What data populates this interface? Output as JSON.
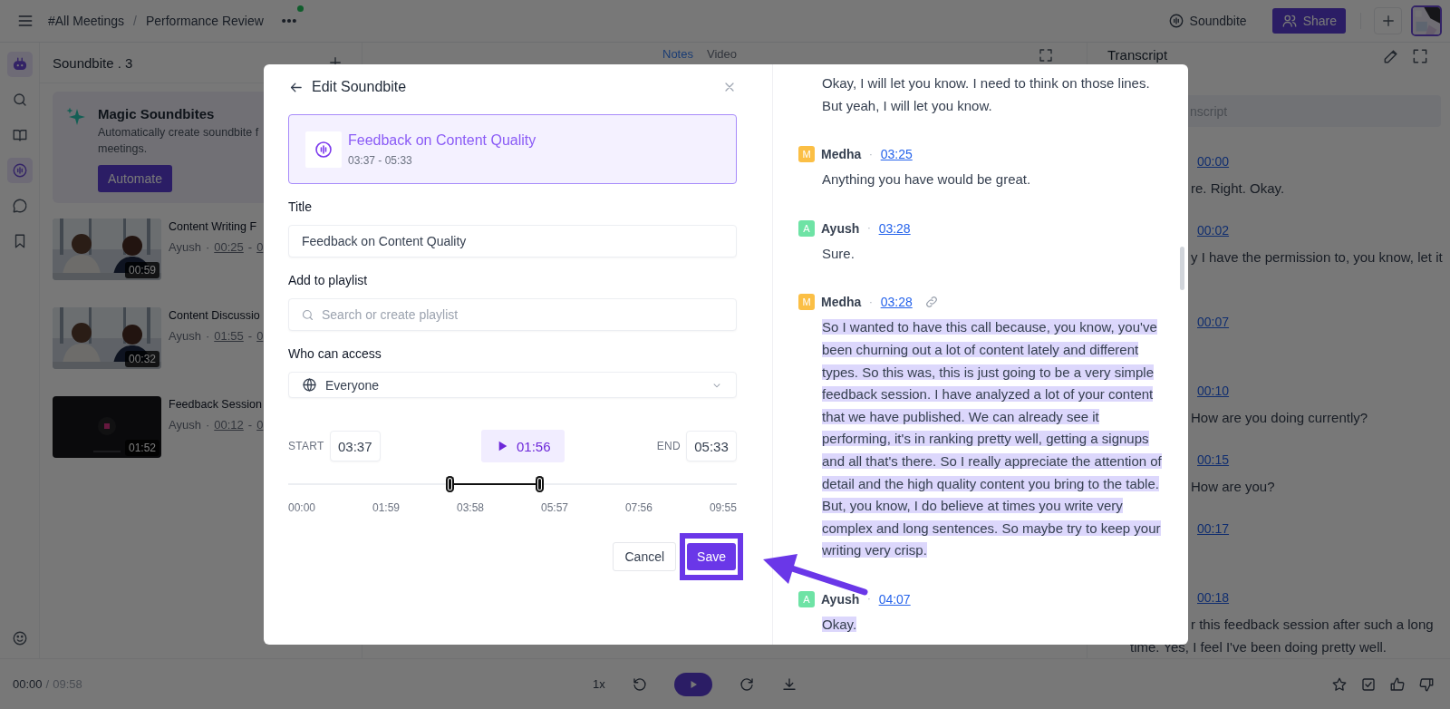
{
  "top_bar": {
    "breadcrumb": [
      {
        "label": "#All Meetings"
      },
      {
        "label": "Performance Review"
      }
    ],
    "separator": "/",
    "more_badge": true,
    "soundbite_button": "Soundbite",
    "share_button": "Share"
  },
  "rail": {
    "items": [
      {
        "kind": "bot",
        "selected": true
      },
      {
        "kind": "search",
        "selected": false
      },
      {
        "kind": "book",
        "selected": false
      },
      {
        "kind": "soundbite",
        "selected": true
      },
      {
        "kind": "chat",
        "selected": false
      },
      {
        "kind": "bookmark",
        "selected": false
      }
    ]
  },
  "soundbite_panel": {
    "title": "Soundbite . 3",
    "magic": {
      "title": "Magic Soundbites",
      "description": "Automatically create soundbite f\nmeetings.",
      "button": "Automate"
    },
    "items": [
      {
        "title": "Content Writing F",
        "author": "Ayush",
        "sep": "·",
        "start": "00:25",
        "dash": "-",
        "end": "0",
        "duration": "00:59"
      },
      {
        "title": "Content Discussio",
        "author": "Ayush",
        "sep": "·",
        "start": "01:55",
        "dash": "-",
        "end": "0",
        "duration": "00:32"
      },
      {
        "title": "Feedback Session",
        "author": "Ayush",
        "sep": "·",
        "start": "00:12",
        "dash": "-",
        "end": "0",
        "duration": "01:52"
      }
    ]
  },
  "notes_panel": {
    "tabs": [
      {
        "label": "Notes",
        "selected": true
      },
      {
        "label": "Video",
        "selected": false
      }
    ]
  },
  "transcript_panel": {
    "title": "Transcript",
    "search_placeholder": "nscript",
    "entries": [
      {
        "time": "00:00",
        "kind": "one_line",
        "lines": [
          {
            "text": "re. Right. Okay.",
            "kind": "clipped"
          }
        ]
      },
      {
        "time": "00:02",
        "kind": "two_line",
        "lines": [
          {
            "text": "y I have the permission to, you know, let it",
            "kind": "clipped"
          }
        ]
      },
      {
        "time": "00:07",
        "kind": "one_line"
      },
      {
        "time": "00:10",
        "kind": "one_line",
        "lines": [
          {
            "text": "How are you doing currently?",
            "kind": "clipped"
          }
        ]
      },
      {
        "time": "00:15",
        "kind": "one_line",
        "lines": [
          {
            "text": "How are you?",
            "kind": "clipped"
          }
        ]
      },
      {
        "time": "00:17",
        "kind": "one_line"
      },
      {
        "time": "00:18",
        "kind": "two_line",
        "lines": [
          {
            "text": "r this feedback session after such a long",
            "kind": "clipped"
          },
          {
            "text": "time. Yes, I feel I've been doing pretty well.",
            "kind": "full"
          }
        ]
      }
    ]
  },
  "player": {
    "current": "00:00",
    "separator": "/",
    "total": "09:58",
    "speed": "1x"
  },
  "dialog": {
    "title": "Edit Soundbite",
    "card": {
      "title": "Feedback on Content Quality",
      "range": "03:37 - 05:33"
    },
    "title_label": "Title",
    "title_value": "Feedback on Content Quality",
    "playlist_label": "Add to playlist",
    "playlist_placeholder": "Search or create playlist",
    "access_label": "Who can access",
    "access_value": "Everyone",
    "start_label": "START",
    "start_value": "03:37",
    "duration": "01:56",
    "end_label": "END",
    "end_value": "05:33",
    "handles": [
      {
        "level": 0.36
      },
      {
        "level": 0.56
      }
    ],
    "ticks": [
      "00:00",
      "01:59",
      "03:58",
      "05:57",
      "07:56",
      "09:55"
    ],
    "cancel": "Cancel",
    "save": "Save",
    "save_highlighted": true,
    "transcript": [
      {
        "text": "Okay, I will let you know. I need to think on those lines. But yeah, I will let you know.",
        "highlighted": false
      },
      {
        "speaker": "Medha",
        "initial": "M",
        "color": "#fbbf45",
        "sep": "·",
        "time": "03:25",
        "link": false,
        "text": "Anything you have would be great.",
        "highlighted": false
      },
      {
        "speaker": "Ayush",
        "initial": "A",
        "color": "#6ee3a5",
        "sep": "·",
        "time": "03:28",
        "link": false,
        "text": "Sure.",
        "highlighted": false
      },
      {
        "speaker": "Medha",
        "initial": "M",
        "color": "#fbbf45",
        "sep": "·",
        "time": "03:28",
        "link": true,
        "text": "So I wanted to have this call because, you know, you've been churning out a lot of content lately and different types. So this was, this is just going to be a very simple feedback session. I have analyzed a lot of your content that we have published. We can already see it performing, it's in ranking pretty well, getting a signups and all that's there. So I really appreciate the attention of detail and the high quality content you bring to the table. But, you know, I do believe at times you write very complex and long sentences. So maybe try to keep your writing very crisp.",
        "highlighted": true
      },
      {
        "speaker": "Ayush",
        "initial": "A",
        "color": "#6ee3a5",
        "sep": "·",
        "time": "04:07",
        "link": false,
        "text": "Okay.",
        "highlighted": true
      }
    ]
  }
}
